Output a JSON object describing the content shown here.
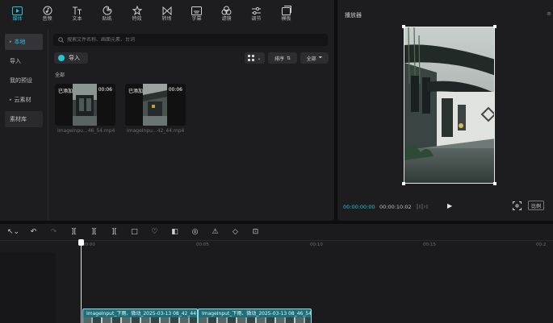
{
  "toolbar": {
    "tabs": [
      {
        "label": "媒体",
        "icon": "media-icon"
      },
      {
        "label": "音频",
        "icon": "audio-icon"
      },
      {
        "label": "文本",
        "icon": "text-icon"
      },
      {
        "label": "贴纸",
        "icon": "sticker-icon"
      },
      {
        "label": "特效",
        "icon": "effects-icon"
      },
      {
        "label": "转场",
        "icon": "transition-icon"
      },
      {
        "label": "字幕",
        "icon": "subtitle-icon"
      },
      {
        "label": "滤镜",
        "icon": "filter-icon"
      },
      {
        "label": "调节",
        "icon": "adjust-icon"
      },
      {
        "label": "模板",
        "icon": "template-icon"
      }
    ]
  },
  "sidebar": {
    "items": [
      {
        "label": "本地",
        "caret": "▸"
      },
      {
        "label": "导入",
        "caret": ""
      },
      {
        "label": "我的预设",
        "caret": ""
      },
      {
        "label": "云素材",
        "caret": "▸"
      },
      {
        "label": "素材库",
        "caret": ""
      }
    ]
  },
  "search": {
    "placeholder": "搜索文件名称、画面元素、台词"
  },
  "import_label": "导入",
  "filters": {
    "sort_label": "排序",
    "all_label": "全部"
  },
  "section_label": "全部",
  "media": [
    {
      "added": "已添加",
      "duration": "00:06",
      "name": "ImageInpu...46_54.mp4"
    },
    {
      "added": "已添加",
      "duration": "00:06",
      "name": "ImageInpu...42_44.mp4"
    }
  ],
  "player": {
    "title": "播放器",
    "menu": "≡",
    "time_current": "00:00:00:00",
    "time_total": "00:00:10:02",
    "play": "▶",
    "ratio": "比例"
  },
  "timeline": {
    "tools": [
      "↖⌄",
      "↶",
      "↷",
      "][",
      "][",
      "][",
      "□",
      "♡",
      "◧",
      "◎",
      "⚠",
      "◇",
      "⊡"
    ],
    "ticks": [
      "00:00",
      "00:05",
      "00:10",
      "00:15",
      "00:2"
    ],
    "clips": [
      {
        "label": "ImageInput_下雨、微动_2025-03-13 08_42_44"
      },
      {
        "label": "ImageInput_下雨、微动_2025-03-13 08_46_54"
      }
    ]
  },
  "colors": {
    "accent": "#25c3d6",
    "panel": "#1d1d20",
    "clip": "#1f6f78"
  }
}
